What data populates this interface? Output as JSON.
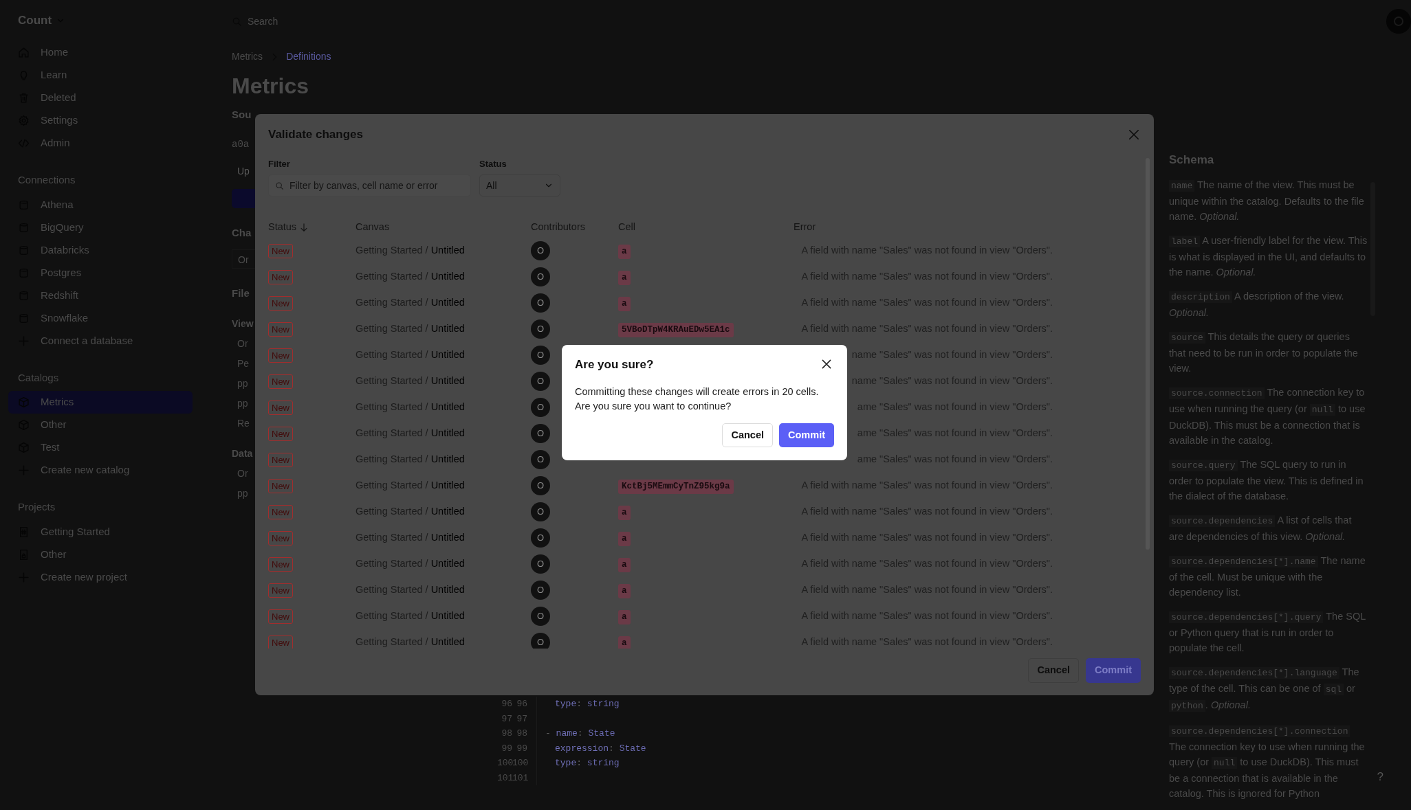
{
  "sidebar": {
    "workspace": "Count",
    "nav": [
      {
        "label": "Home",
        "selected": false
      },
      {
        "label": "Learn",
        "selected": false
      },
      {
        "label": "Deleted",
        "selected": false
      },
      {
        "label": "Settings",
        "selected": false
      },
      {
        "label": "Admin",
        "selected": false
      }
    ],
    "sections": [
      {
        "title": "Connections",
        "items": [
          {
            "label": "Athena",
            "kind": "database",
            "selected": false
          },
          {
            "label": "BigQuery",
            "kind": "database",
            "selected": false
          },
          {
            "label": "Databricks",
            "kind": "database",
            "selected": false
          },
          {
            "label": "Postgres",
            "kind": "database",
            "selected": false
          },
          {
            "label": "Redshift",
            "kind": "database",
            "selected": false
          },
          {
            "label": "Snowflake",
            "kind": "database",
            "selected": false
          },
          {
            "label": "Connect a database",
            "kind": "add",
            "selected": false
          }
        ]
      },
      {
        "title": "Catalogs",
        "items": [
          {
            "label": "Metrics",
            "kind": "catalog",
            "selected": true
          },
          {
            "label": "Other",
            "kind": "catalog",
            "selected": false
          },
          {
            "label": "Test",
            "kind": "catalog",
            "selected": false
          },
          {
            "label": "Create new catalog",
            "kind": "add",
            "selected": false
          }
        ]
      },
      {
        "title": "Projects",
        "items": [
          {
            "label": "Getting Started",
            "kind": "canvas",
            "selected": false
          },
          {
            "label": "Other",
            "kind": "private_canvas",
            "selected": false
          },
          {
            "label": "Create new project",
            "kind": "add",
            "selected": false
          }
        ]
      }
    ]
  },
  "topbar": {
    "search_placeholder": "Search"
  },
  "page": {
    "breadcrumb": [
      {
        "label": "Metrics",
        "current": false
      },
      {
        "label": "Definitions",
        "current": true
      }
    ],
    "title": "Metrics",
    "fragments": [
      {
        "kind": "heading",
        "text": "Sou"
      },
      {
        "kind": "mono",
        "text": "a0a"
      },
      {
        "kind": "placeholder",
        "text": "Up"
      },
      {
        "kind": "button"
      },
      {
        "kind": "heading",
        "text": "Cha"
      },
      {
        "kind": "field",
        "text": "Or"
      },
      {
        "kind": "heading",
        "text": "File"
      },
      {
        "kind": "subheading",
        "text": "View"
      },
      {
        "kind": "item",
        "text": "Or"
      },
      {
        "kind": "item",
        "text": "Pe"
      },
      {
        "kind": "item",
        "text": "pp"
      },
      {
        "kind": "item",
        "text": "pp"
      },
      {
        "kind": "item",
        "text": "Re"
      },
      {
        "kind": "subheading",
        "text": "Data"
      },
      {
        "kind": "item",
        "text": "Or"
      },
      {
        "kind": "item",
        "text": "pp"
      }
    ]
  },
  "code_editor": {
    "lines": [
      {
        "old": "96",
        "new": "96",
        "code": [
          {
            "kind": "key",
            "text": "type"
          },
          {
            "kind": "punct",
            "text": ": "
          },
          {
            "kind": "value",
            "text": "string"
          }
        ],
        "indent": true
      },
      {
        "old": "97",
        "new": "97",
        "indent": false
      },
      {
        "old": "98",
        "new": "98",
        "code": [
          {
            "kind": "punct",
            "text": "- "
          },
          {
            "kind": "key",
            "text": "name"
          },
          {
            "kind": "punct",
            "text": ": "
          },
          {
            "kind": "value",
            "text": "State"
          }
        ],
        "indent": false
      },
      {
        "old": "99",
        "new": "99",
        "code": [
          {
            "kind": "key",
            "text": "expression"
          },
          {
            "kind": "punct",
            "text": ": "
          },
          {
            "kind": "value",
            "text": "State"
          }
        ],
        "indent": true
      },
      {
        "old": "100",
        "new": "100",
        "code": [
          {
            "kind": "key",
            "text": "type"
          },
          {
            "kind": "punct",
            "text": ": "
          },
          {
            "kind": "value",
            "text": "string"
          }
        ],
        "indent": true
      },
      {
        "old": "101",
        "new": "101",
        "indent": false
      }
    ]
  },
  "schema": {
    "title": "Schema",
    "entries": [
      [
        {
          "kind": "code",
          "text": "name"
        },
        {
          "kind": "text",
          "text": " The name of the view. This must be unique within the catalog. Defaults to the file name. "
        },
        {
          "kind": "em",
          "text": "Optional."
        }
      ],
      [
        {
          "kind": "code",
          "text": "label"
        },
        {
          "kind": "text",
          "text": " A user-friendly label for the view. This is what is displayed in the UI, and defaults to the name. "
        },
        {
          "kind": "em",
          "text": "Optional."
        }
      ],
      [
        {
          "kind": "code",
          "text": "description"
        },
        {
          "kind": "text",
          "text": " A description of the view. "
        },
        {
          "kind": "em",
          "text": "Optional."
        }
      ],
      [
        {
          "kind": "code",
          "text": "source"
        },
        {
          "kind": "text",
          "text": " This details the query or queries that need to be run in order to populate the view."
        }
      ],
      [
        {
          "kind": "code",
          "text": "source.connection"
        },
        {
          "kind": "text",
          "text": " The connection key to use when running the query (or "
        },
        {
          "kind": "code",
          "text": "null"
        },
        {
          "kind": "text",
          "text": " to use DuckDB). This must be a connection that is available in the catalog."
        }
      ],
      [
        {
          "kind": "code",
          "text": "source.query"
        },
        {
          "kind": "text",
          "text": " The SQL query to run in order to populate the view. This is defined in the dialect of the database."
        }
      ],
      [
        {
          "kind": "code",
          "text": "source.dependencies"
        },
        {
          "kind": "text",
          "text": " A list of cells that are dependencies of this view. "
        },
        {
          "kind": "em",
          "text": "Optional."
        }
      ],
      [
        {
          "kind": "code",
          "text": "source.dependencies[*].name"
        },
        {
          "kind": "text",
          "text": " The name of the cell. Must be unique with the dependency list."
        }
      ],
      [
        {
          "kind": "code",
          "text": "source.dependencies[*].query"
        },
        {
          "kind": "text",
          "text": " The SQL or Python query that is run in order to populate the cell."
        }
      ],
      [
        {
          "kind": "code",
          "text": "source.dependencies[*].language"
        },
        {
          "kind": "text",
          "text": " The type of the cell. This can be one of "
        },
        {
          "kind": "code",
          "text": "sql"
        },
        {
          "kind": "text",
          "text": " or "
        },
        {
          "kind": "code",
          "text": "python"
        },
        {
          "kind": "text",
          "text": ". "
        },
        {
          "kind": "em",
          "text": "Optional."
        }
      ],
      [
        {
          "kind": "code",
          "text": "source.dependencies[*].connection"
        },
        {
          "kind": "text",
          "text": " The connection key to use when running the query (or "
        },
        {
          "kind": "code",
          "text": "null"
        },
        {
          "kind": "text",
          "text": " to use DuckDB). This must be a connection that is available in the catalog. This is ignored for Python"
        }
      ]
    ]
  },
  "help": "?",
  "modal": {
    "title": "Validate changes",
    "filter_label": "Filter",
    "filter_placeholder": "Filter by canvas, cell name or error",
    "status_label": "Status",
    "status_value": "All",
    "columns": [
      {
        "label": "Status",
        "sorted": true
      },
      {
        "label": "Canvas",
        "sorted": false
      },
      {
        "label": "Contributors",
        "sorted": false
      },
      {
        "label": "Cell",
        "sorted": false
      },
      {
        "label": "Error",
        "sorted": false
      }
    ],
    "rows": [
      {
        "status": "New",
        "canvas": {
          "parent": "Getting Started",
          "separator": "/",
          "name": "Untitled"
        },
        "contributor": "O",
        "cell": "a",
        "error": "A field with name \"Sales\" was not found in view \"Orders\"."
      },
      {
        "status": "New",
        "canvas": {
          "parent": "Getting Started",
          "separator": "/",
          "name": "Untitled"
        },
        "contributor": "O",
        "cell": "a",
        "error": "A field with name \"Sales\" was not found in view \"Orders\"."
      },
      {
        "status": "New",
        "canvas": {
          "parent": "Getting Started",
          "separator": "/",
          "name": "Untitled"
        },
        "contributor": "O",
        "cell": "a",
        "error": "A field with name \"Sales\" was not found in view \"Orders\"."
      },
      {
        "status": "New",
        "canvas": {
          "parent": "Getting Started",
          "separator": "/",
          "name": "Untitled"
        },
        "contributor": "O",
        "cell": "5VBoDTpW4KRAuEDw5EA1c",
        "error": "A field with name \"Sales\" was not found in view \"Orders\"."
      },
      {
        "status": "New",
        "canvas": {
          "parent": "Getting Started",
          "separator": "/",
          "name": "Untitled"
        },
        "contributor": "O",
        "error": "name \"Sales\" was not found in view \"Orders\"."
      },
      {
        "status": "New",
        "canvas": {
          "parent": "Getting Started",
          "separator": "/",
          "name": "Untitled"
        },
        "contributor": "O",
        "error": "name \"Sales\" was not found in view \"Orders\"."
      },
      {
        "status": "New",
        "canvas": {
          "parent": "Getting Started",
          "separator": "/",
          "name": "Untitled"
        },
        "contributor": "O",
        "error": "ame \"Sales\" was not found in view \"Orders\"."
      },
      {
        "status": "New",
        "canvas": {
          "parent": "Getting Started",
          "separator": "/",
          "name": "Untitled"
        },
        "contributor": "O",
        "error": "ame \"Sales\" was not found in view \"Orders\"."
      },
      {
        "status": "New",
        "canvas": {
          "parent": "Getting Started",
          "separator": "/",
          "name": "Untitled"
        },
        "contributor": "O",
        "error": "ame \"Sales\" was not found in view \"Orders\"."
      },
      {
        "status": "New",
        "canvas": {
          "parent": "Getting Started",
          "separator": "/",
          "name": "Untitled"
        },
        "contributor": "O",
        "cell": "KctBj5MEmmCyTnZ95kg9a",
        "error": "A field with name \"Sales\" was not found in view \"Orders\"."
      },
      {
        "status": "New",
        "canvas": {
          "parent": "Getting Started",
          "separator": "/",
          "name": "Untitled"
        },
        "contributor": "O",
        "cell": "a",
        "error": "A field with name \"Sales\" was not found in view \"Orders\"."
      },
      {
        "status": "New",
        "canvas": {
          "parent": "Getting Started",
          "separator": "/",
          "name": "Untitled"
        },
        "contributor": "O",
        "cell": "a",
        "error": "A field with name \"Sales\" was not found in view \"Orders\"."
      },
      {
        "status": "New",
        "canvas": {
          "parent": "Getting Started",
          "separator": "/",
          "name": "Untitled"
        },
        "contributor": "O",
        "cell": "a",
        "error": "A field with name \"Sales\" was not found in view \"Orders\"."
      },
      {
        "status": "New",
        "canvas": {
          "parent": "Getting Started",
          "separator": "/",
          "name": "Untitled"
        },
        "contributor": "O",
        "cell": "a",
        "error": "A field with name \"Sales\" was not found in view \"Orders\"."
      },
      {
        "status": "New",
        "canvas": {
          "parent": "Getting Started",
          "separator": "/",
          "name": "Untitled"
        },
        "contributor": "O",
        "cell": "a",
        "error": "A field with name \"Sales\" was not found in view \"Orders\"."
      },
      {
        "status": "New",
        "canvas": {
          "parent": "Getting Started",
          "separator": "/",
          "name": "Untitled"
        },
        "contributor": "O",
        "cell": "a",
        "error": "A field with name \"Sales\" was not found in view \"Orders\"."
      }
    ],
    "buttons": [
      {
        "label": "Cancel",
        "kind": "secondary"
      },
      {
        "label": "Commit",
        "kind": "primary"
      }
    ]
  },
  "confirm": {
    "title": "Are you sure?",
    "message": "Committing these changes will create errors in 20 cells. Are you sure you want to continue?",
    "buttons": [
      {
        "label": "Cancel",
        "kind": "secondary"
      },
      {
        "label": "Commit",
        "kind": "primary"
      }
    ]
  }
}
